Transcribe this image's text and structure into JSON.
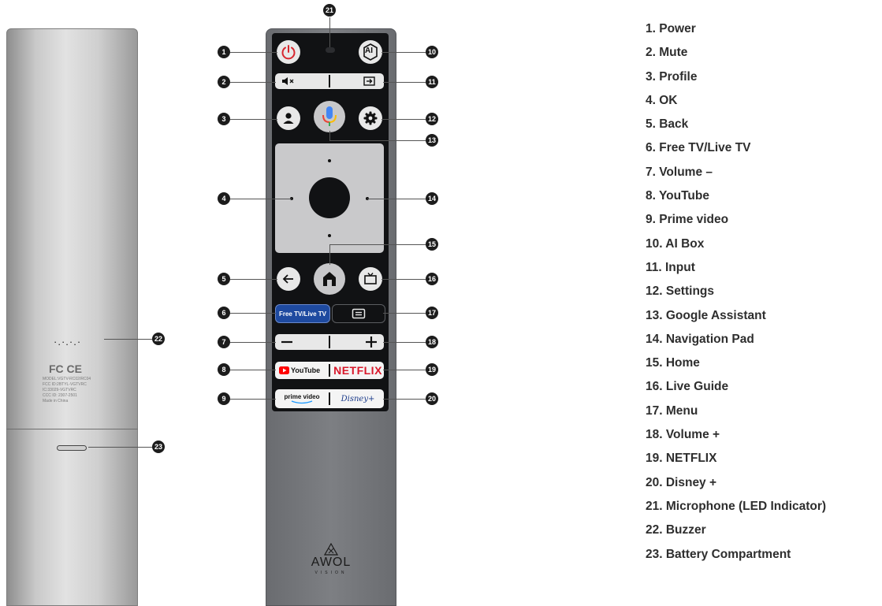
{
  "legend": [
    "1.  Power",
    "2.  Mute",
    "3.  Profile",
    "4.  OK",
    "5.  Back",
    "6.  Free TV/Live TV",
    "7.  Volume –",
    "8.  YouTube",
    "9.  Prime video",
    "10.  AI Box",
    "11.  Input",
    "12.  Settings",
    "13.  Google Assistant",
    "14.  Navigation Pad",
    "15.  Home",
    "16.  Live Guide",
    "17.  Menu",
    "18.  Volume +",
    "19.  NETFLIX",
    "20.  Disney +",
    "21.  Microphone (LED Indicator)",
    "22.  Buzzer",
    "23.  Battery Compartment"
  ],
  "callouts": [
    "1",
    "2",
    "3",
    "4",
    "5",
    "6",
    "7",
    "8",
    "9",
    "10",
    "11",
    "12",
    "13",
    "14",
    "15",
    "16",
    "17",
    "18",
    "19",
    "20",
    "21",
    "22",
    "23"
  ],
  "remote_front": {
    "ai_label": "AI",
    "free_tv_label": "Free TV/Live TV",
    "youtube_label": "YouTube",
    "netflix_label": "NETFLIX",
    "prime_label": "prime video",
    "disney_label": "Disney+",
    "brand": "AWOL",
    "brand_sub": "VISION"
  },
  "remote_back": {
    "cert_marks": "FC CE",
    "cert_lines": [
      "MODEL:VGTV-RC02/RC04",
      "FCC ID:2BTYL-VGTVRC",
      "IC:33029-VGTVRC",
      "CCC ID: 2307-2501",
      "Made in China"
    ]
  },
  "colors": {
    "power": "#d7262e",
    "free_tv_bg": "#1e4aa0",
    "netflix": "#d8172a",
    "youtube": "#ff0000",
    "mic_blue": "#4285f4",
    "callout_bg": "#1c1c1c"
  },
  "icons": {
    "power": "power-icon",
    "mute": "mute-icon",
    "input": "input-icon",
    "profile": "user-icon",
    "mic": "microphone-icon",
    "settings": "gear-icon",
    "back": "arrow-left-icon",
    "home": "home-icon",
    "live_guide": "tv-icon",
    "menu": "menu-icon",
    "volume_minus": "minus-icon",
    "volume_plus": "plus-icon"
  }
}
